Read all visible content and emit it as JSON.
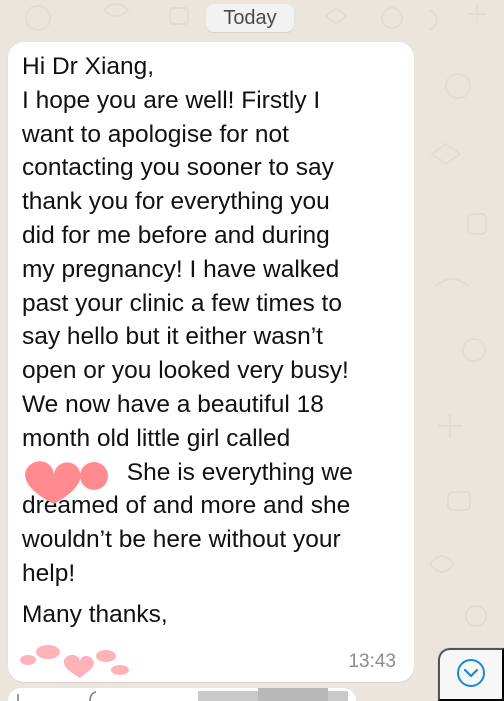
{
  "header": {
    "date_label": "Today"
  },
  "message": {
    "text": "Hi Dr Xiang,\nI hope you are well! Firstly I\nwant to apologise for not\ncontacting you sooner to say\nthank you for everything you\ndid for me before and during\nmy pregnancy! I have walked\npast your clinic a few times to\nsay hello but it either wasn’t\nopen or you looked very busy!\nWe now have a beautiful 18\nmonth old little girl called\n     She is everything we\ndreamed of and more and she\nwouldn’t be here without your\nhelp!",
    "signoff": "Many thanks,",
    "time": "13:43"
  },
  "controls": {
    "scroll_icon": "chevron-down-icon"
  },
  "colors": {
    "chat_background": "#ECE5DD",
    "bubble_background": "#FFFFFF",
    "text": "#111111",
    "timestamp": "#8C8C8C",
    "accent": "#1D88D8",
    "redaction_pink": "#FF8A8F"
  }
}
